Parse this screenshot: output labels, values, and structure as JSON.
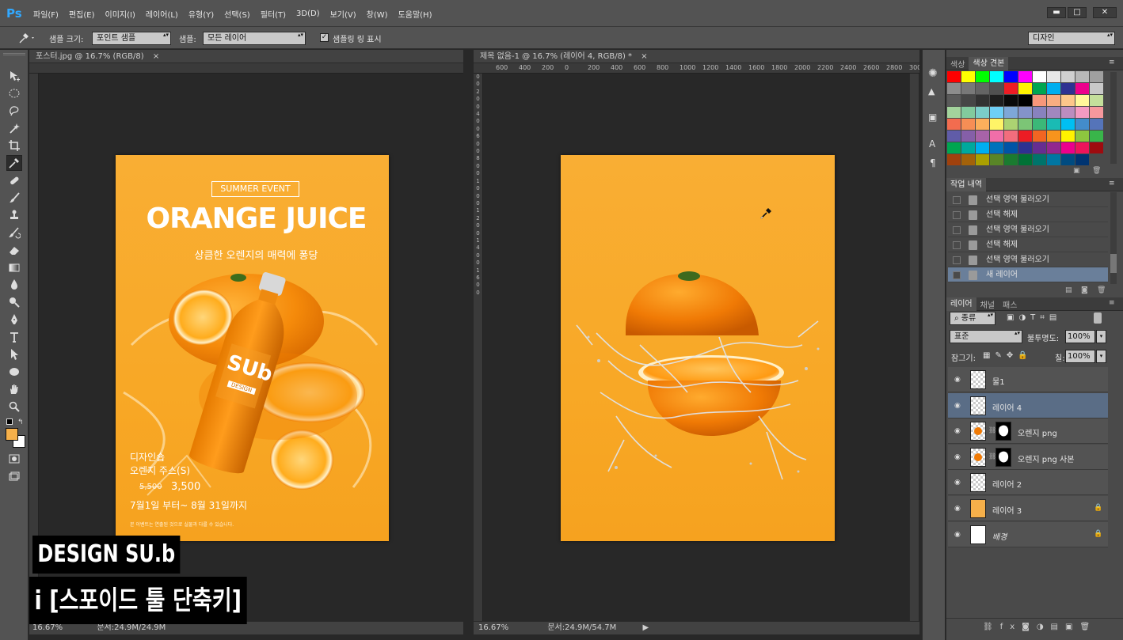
{
  "app": {
    "logo": "Ps",
    "menus": [
      "파일(F)",
      "편집(E)",
      "이미지(I)",
      "레이어(L)",
      "유형(Y)",
      "선택(S)",
      "필터(T)",
      "3D(D)",
      "보기(V)",
      "창(W)",
      "도움말(H)"
    ],
    "window_buttons": [
      "▬",
      "□",
      "✕"
    ]
  },
  "options": {
    "tool_icon": "eyedropper-icon",
    "sample_size_label": "샘플 크기:",
    "sample_size_value": "포인트 샘플",
    "sample_label": "샘플:",
    "sample_value": "모든 레이어",
    "show_ring_label": "샘플링 링 표시",
    "show_ring_checked": true,
    "workspace": "디자인"
  },
  "tools": [
    "move-icon",
    "marquee-icon",
    "lasso-icon",
    "quick-select-icon",
    "crop-icon",
    "eyedropper-icon",
    "healing-icon",
    "brush-icon",
    "stamp-icon",
    "history-brush-icon",
    "eraser-icon",
    "gradient-icon",
    "blur-icon",
    "dodge-icon",
    "pen-icon",
    "type-icon",
    "path-select-icon",
    "ellipse-icon",
    "hand-icon",
    "zoom-icon"
  ],
  "foreground_color": "#f6b04a",
  "background_color": "#ffffff",
  "doc1": {
    "tab": "포스터.jpg @ 16.7% (RGB/8)",
    "close": "×",
    "zoom": "16.67%",
    "status": "문서:24.9M/24.9M",
    "poster": {
      "event": "SUMMER EVENT",
      "title": "ORANGE JUICE",
      "subtitle": "상큼한 오렌지의 매력에 퐁당",
      "brand": "SUb",
      "brand_sub": "DESIGN",
      "shop": "디자인숍",
      "product": "오렌지 주스(S)",
      "old_price": "5,500",
      "price": "3,500",
      "period": "7월1일 부터~ 8월 31일까지",
      "footnote": "본 이벤트는 연출된 것으로 실물과 다를 수 있습니다."
    }
  },
  "doc2": {
    "tab": "제목 없음-1 @ 16.7% (레이어 4, RGB/8) *",
    "close": "×",
    "ruler_h": [
      "600",
      "400",
      "200",
      "0",
      "200",
      "400",
      "600",
      "800",
      "1000",
      "1200",
      "1400",
      "1600",
      "1800",
      "2000",
      "2200",
      "2400",
      "2600",
      "2800",
      "3000"
    ],
    "ruler_v": [
      "0",
      "0",
      "2",
      "0",
      "0",
      "4",
      "0",
      "0",
      "6",
      "0",
      "0",
      "8",
      "0",
      "0",
      "1",
      "0",
      "0",
      "0",
      "1",
      "2",
      "0",
      "0",
      "1",
      "4",
      "0",
      "0",
      "1",
      "6",
      "0",
      "0"
    ],
    "zoom": "16.67%",
    "status": "문서:24.9M/54.7M"
  },
  "swatches_panel": {
    "tabs": [
      "색상",
      "색상 견본"
    ],
    "active_tab": 1,
    "colors": [
      "#ff0000",
      "#ffff00",
      "#00ff00",
      "#00ffff",
      "#0000ff",
      "#ff00ff",
      "#ffffff",
      "#e8e8e8",
      "#d0d0d0",
      "#b8b8b8",
      "#a0a0a0",
      "#8c8c8c",
      "#787878",
      "#646464",
      "#505050",
      "#ee1c24",
      "#fff200",
      "#00a651",
      "#00aeef",
      "#2e3192",
      "#ec008c",
      "#c8c8c8",
      "#5a5a5a",
      "#464646",
      "#323232",
      "#1e1e1e",
      "#0a0a0a",
      "#000000",
      "#f7977a",
      "#f9ad81",
      "#fdc68a",
      "#fff79a",
      "#c4df9b",
      "#a3d39c",
      "#82ca9d",
      "#7bcdc8",
      "#6ecff6",
      "#7ea7d8",
      "#8493ca",
      "#8882be",
      "#a187be",
      "#bc8dbf",
      "#f49ac2",
      "#f6989d",
      "#f26c4f",
      "#f68e55",
      "#fbaf5c",
      "#fff467",
      "#acd372",
      "#7cc576",
      "#3bb878",
      "#1abbb4",
      "#00bff3",
      "#438ccb",
      "#5574b9",
      "#605ca8",
      "#855fa8",
      "#a763a8",
      "#f06ea9",
      "#f26d7d",
      "#ed1c24",
      "#f26522",
      "#f7941d",
      "#fff200",
      "#8dc63f",
      "#39b54a",
      "#00a651",
      "#00a99d",
      "#00aeef",
      "#0072bc",
      "#0054a6",
      "#2e3192",
      "#662d91",
      "#92278f",
      "#ec008c",
      "#ed145b",
      "#9e0b0f",
      "#a0410d",
      "#a3620a",
      "#aba000",
      "#598527",
      "#1a7b30",
      "#007236",
      "#00746b",
      "#0076a3",
      "#004b80",
      "#003471"
    ]
  },
  "history_panel": {
    "tabs": [
      "작업 내역"
    ],
    "items": [
      {
        "label": "선택 영역 불러오기",
        "selected": false
      },
      {
        "label": "선택 해제",
        "selected": false
      },
      {
        "label": "선택 영역 불러오기",
        "selected": false
      },
      {
        "label": "선택 해제",
        "selected": false
      },
      {
        "label": "선택 영역 불러오기",
        "selected": false
      },
      {
        "label": "새 레이어",
        "selected": true
      }
    ]
  },
  "layers_panel": {
    "tabs": [
      "레이어",
      "채널",
      "패스"
    ],
    "filter": "종류",
    "blend_mode": "표준",
    "opacity_label": "불투명도:",
    "opacity_value": "100%",
    "lock_label": "잠그기:",
    "fill_label": "칠:",
    "fill_value": "100%",
    "layers": [
      {
        "name": "물1",
        "selected": false,
        "mask": false,
        "locked": false,
        "italic": false,
        "thumb": "transparent"
      },
      {
        "name": "레이어 4",
        "selected": true,
        "mask": false,
        "locked": false,
        "italic": false,
        "thumb": "transparent"
      },
      {
        "name": "오렌지 png",
        "selected": false,
        "mask": true,
        "locked": false,
        "italic": false,
        "thumb": "orange"
      },
      {
        "name": "오렌지 png 사본",
        "selected": false,
        "mask": true,
        "locked": false,
        "italic": false,
        "thumb": "orange"
      },
      {
        "name": "레이어 2",
        "selected": false,
        "mask": false,
        "locked": false,
        "italic": false,
        "thumb": "transparent"
      },
      {
        "name": "레이어 3",
        "selected": false,
        "mask": false,
        "locked": true,
        "italic": false,
        "thumb": "#f6b04a"
      },
      {
        "name": "배경",
        "selected": false,
        "mask": false,
        "locked": true,
        "italic": true,
        "thumb": "#ffffff"
      }
    ]
  },
  "captions": {
    "line1": "DESIGN SU.b",
    "line2": "i [스포이드 툴 단축키]"
  }
}
